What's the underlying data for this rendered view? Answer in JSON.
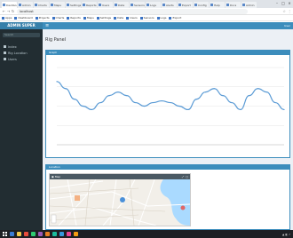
{
  "browser": {
    "tabs": [
      {
        "label": "Dashboard"
      },
      {
        "label": "Admin"
      },
      {
        "label": "Charts"
      },
      {
        "label": "Maps"
      },
      {
        "label": "Settings"
      },
      {
        "label": "Reports"
      },
      {
        "label": "Users"
      },
      {
        "label": "Data"
      },
      {
        "label": "Sensors"
      },
      {
        "label": "Logs"
      },
      {
        "label": "Alerts"
      },
      {
        "label": "Export"
      },
      {
        "label": "Config"
      },
      {
        "label": "Help"
      },
      {
        "label": "Docs"
      },
      {
        "label": "Admin"
      }
    ],
    "url": "localhost",
    "bookmarks": [
      "Apps",
      "Dashboard",
      "Projects",
      "Charts",
      "Reports",
      "Maps",
      "Settings",
      "Data",
      "Users",
      "Sensors",
      "Logs",
      "Export"
    ]
  },
  "app": {
    "brand": "ADMIN SUPER",
    "menu_icon": "≡",
    "user_label": "User"
  },
  "sidebar": {
    "search_placeholder": "Search",
    "items": [
      {
        "label": "Index",
        "icon": "dashboard-icon"
      },
      {
        "label": "Rig Location",
        "icon": "map-icon"
      },
      {
        "label": "Users",
        "icon": "users-icon"
      }
    ]
  },
  "page": {
    "title": "Rig Panel"
  },
  "chart_box": {
    "header": "Graph"
  },
  "map_box": {
    "header": "Location",
    "panel_label": "Map"
  },
  "chart_data": {
    "type": "line",
    "title": "",
    "xlabel": "",
    "ylabel": "",
    "x": [
      0,
      1,
      2,
      3,
      4,
      5,
      6,
      7,
      8,
      9,
      10,
      11,
      12,
      13,
      14,
      15,
      16,
      17,
      18,
      19,
      20,
      21,
      22,
      23,
      24,
      25,
      26
    ],
    "series": [
      {
        "values": [
          18,
          16,
          13,
          11,
          10,
          12,
          14,
          15,
          14,
          12,
          11,
          12,
          12.5,
          12,
          11,
          10,
          13,
          15,
          16,
          14,
          12,
          10,
          14,
          16,
          15,
          12,
          10
        ]
      }
    ],
    "ylim": [
      0,
      22
    ],
    "grid": true,
    "color": "#5b9bd5"
  },
  "colors": {
    "primary": "#3c8dbc",
    "sidebar": "#222d32",
    "content_bg": "#ecf0f5",
    "map_water": "#aadaff",
    "marker": "#4a90d9"
  }
}
